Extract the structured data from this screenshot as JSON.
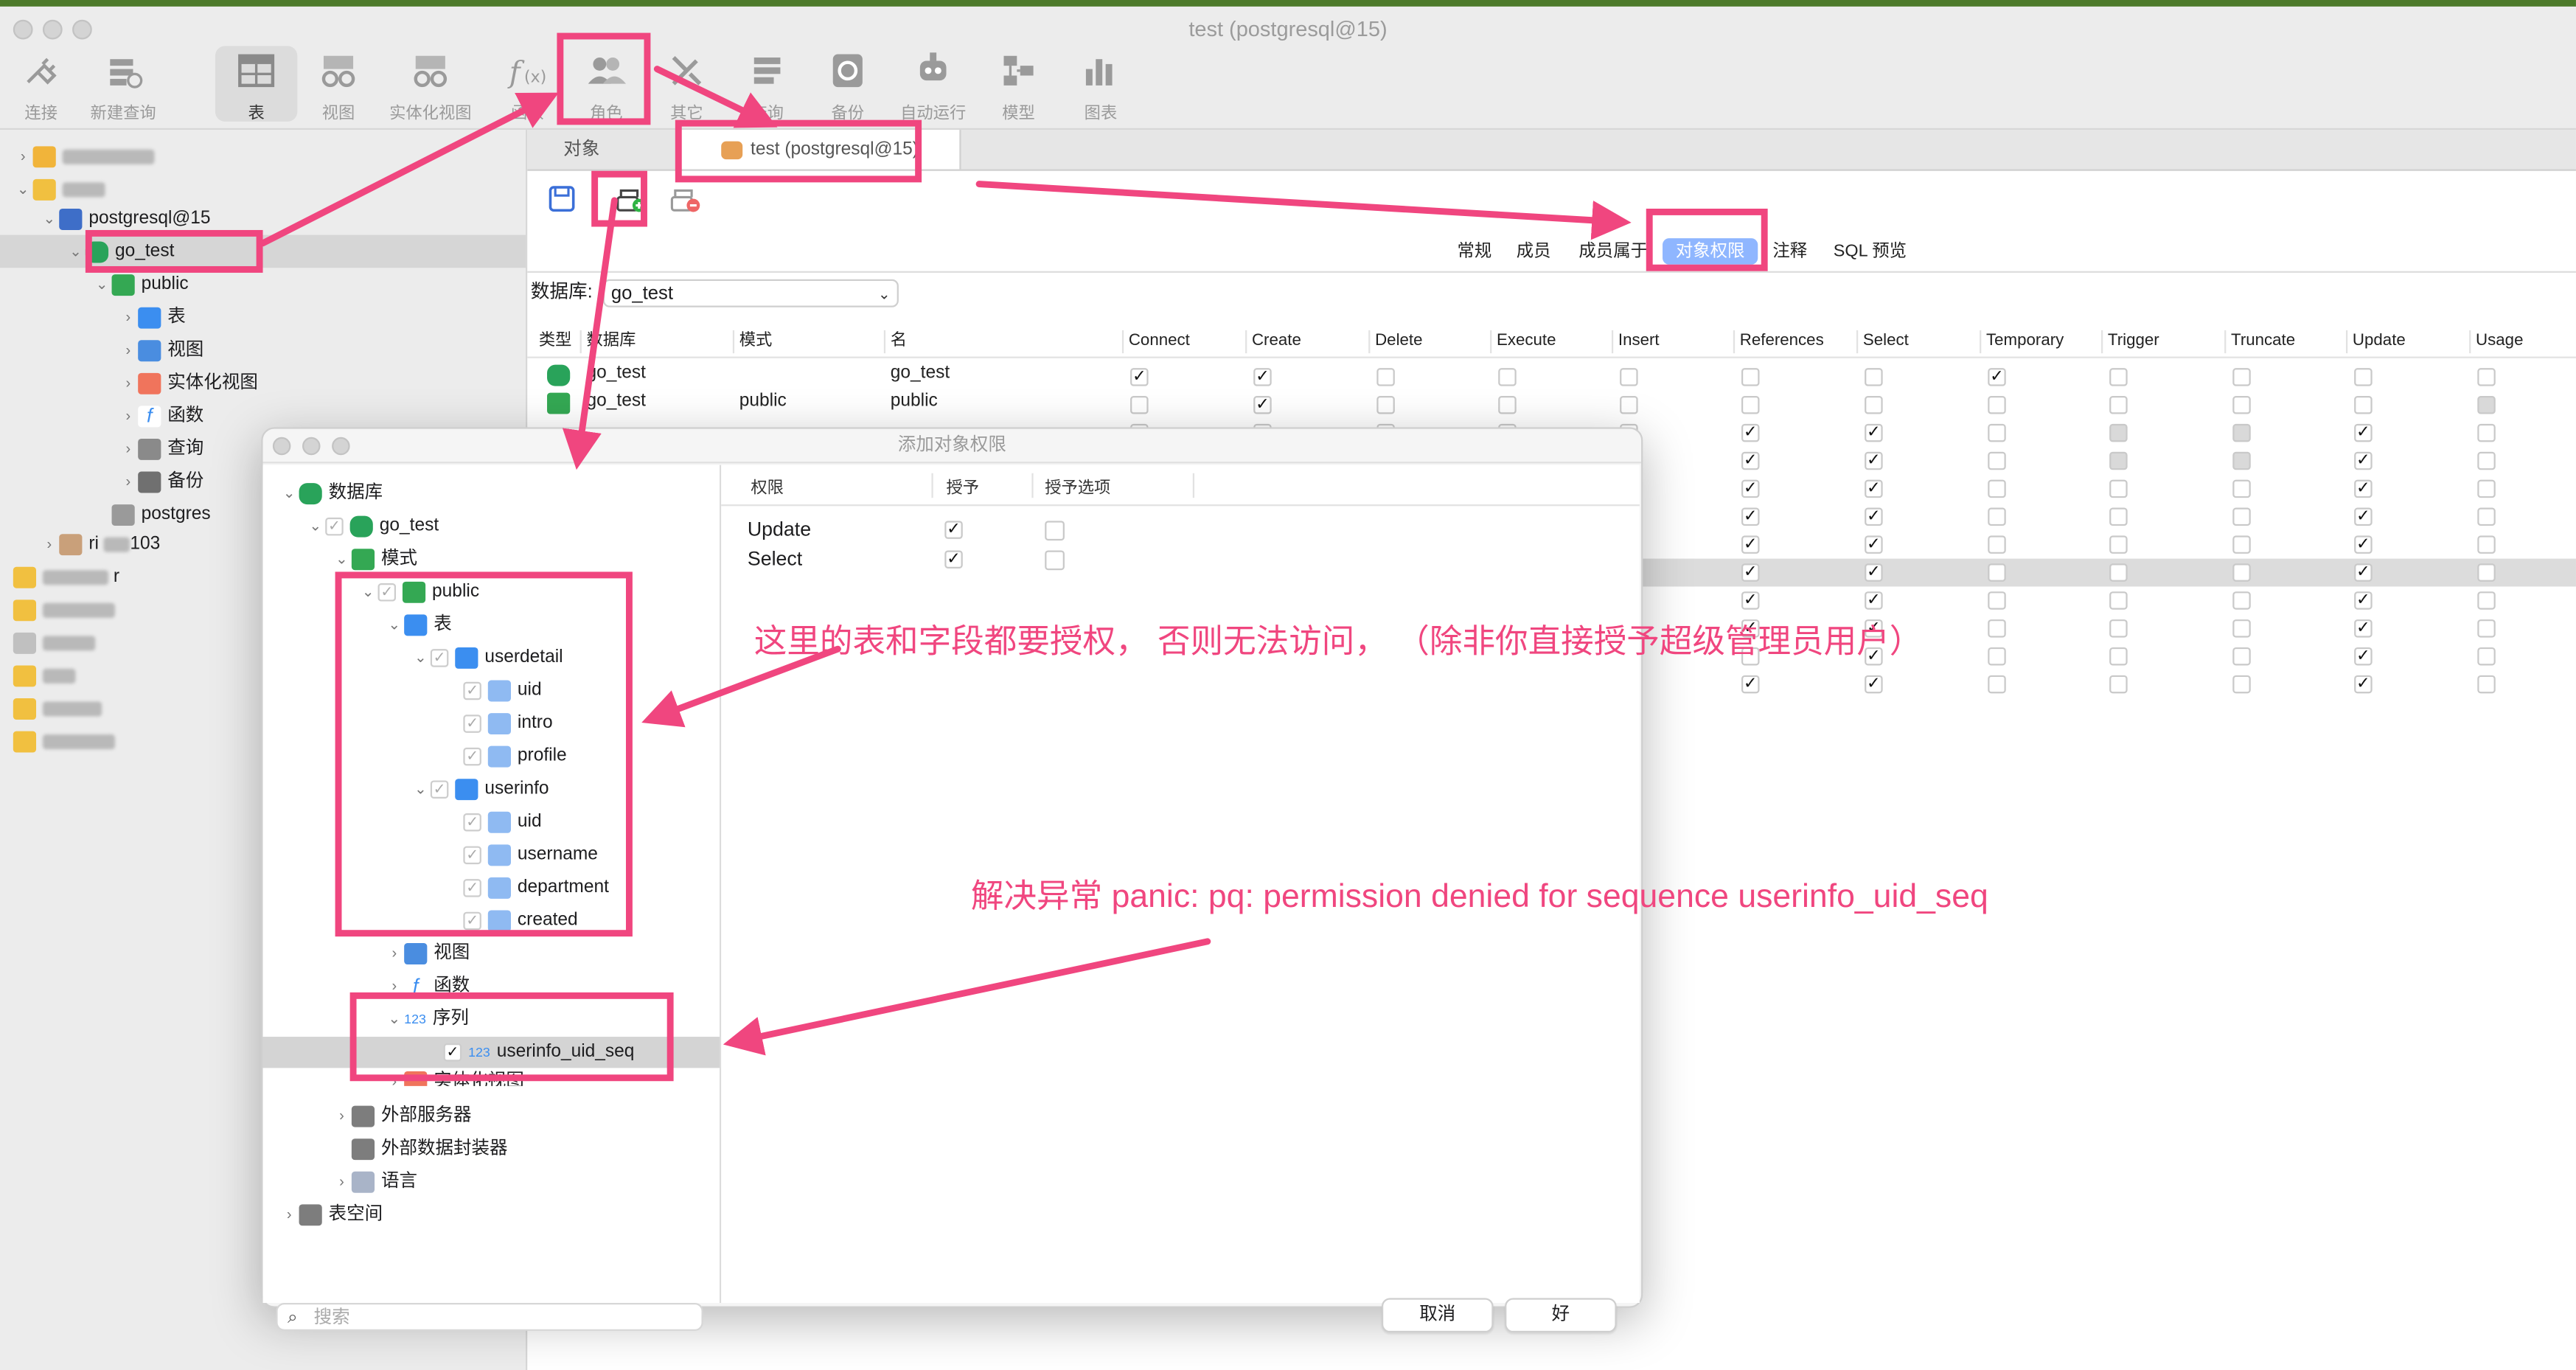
{
  "window": {
    "title": "test (postgresql@15)"
  },
  "toolbar": {
    "items": [
      {
        "label": "连接",
        "icon": "plug-icon"
      },
      {
        "label": "新建查询",
        "icon": "new-query-icon"
      },
      {
        "label": "表",
        "icon": "table-icon"
      },
      {
        "label": "视图",
        "icon": "view-icon"
      },
      {
        "label": "实体化视图",
        "icon": "materialized-view-icon"
      },
      {
        "label": "函数",
        "icon": "function-icon"
      },
      {
        "label": "角色",
        "icon": "roles-icon"
      },
      {
        "label": "其它",
        "icon": "tools-icon"
      },
      {
        "label": "查询",
        "icon": "query-icon"
      },
      {
        "label": "备份",
        "icon": "backup-icon"
      },
      {
        "label": "自动运行",
        "icon": "robot-icon"
      },
      {
        "label": "模型",
        "icon": "model-icon"
      },
      {
        "label": "图表",
        "icon": "chart-icon"
      }
    ]
  },
  "sidebar": {
    "items": [
      {
        "label": "postgresql@15"
      },
      {
        "label": "go_test"
      },
      {
        "label": "public"
      },
      {
        "label": "表"
      },
      {
        "label": "视图"
      },
      {
        "label": "实体化视图"
      },
      {
        "label": "函数"
      },
      {
        "label": "查询"
      },
      {
        "label": "备份"
      },
      {
        "label": "postgres"
      },
      {
        "label": "ri",
        "suffix": "103"
      },
      {
        "label": "r"
      }
    ]
  },
  "tabs": [
    {
      "label": "对象"
    },
    {
      "label": "test (postgresql@15)"
    }
  ],
  "subtabs": [
    {
      "label": "常规"
    },
    {
      "label": "成员"
    },
    {
      "label": "成员属于"
    },
    {
      "label": "对象权限"
    },
    {
      "label": "注释"
    },
    {
      "label": "SQL 预览"
    }
  ],
  "db_filter": {
    "label": "数据库:",
    "value": "go_test"
  },
  "grid": {
    "headers": [
      "类型",
      "数据库",
      "模式",
      "名",
      "Connect",
      "Create",
      "Delete",
      "Execute",
      "Insert",
      "References",
      "Select",
      "Temporary",
      "Trigger",
      "Truncate",
      "Update",
      "Usage"
    ],
    "rows": [
      {
        "db": "go_test",
        "schema": "",
        "name": "go_test"
      },
      {
        "db": "go_test",
        "schema": "public",
        "name": "public"
      }
    ]
  },
  "dialog": {
    "title": "添加对象权限",
    "tree": [
      {
        "label": "数据库"
      },
      {
        "label": "go_test"
      },
      {
        "label": "模式"
      },
      {
        "label": "public"
      },
      {
        "label": "表"
      },
      {
        "label": "userdetail"
      },
      {
        "label": "uid"
      },
      {
        "label": "intro"
      },
      {
        "label": "profile"
      },
      {
        "label": "userinfo"
      },
      {
        "label": "uid"
      },
      {
        "label": "username"
      },
      {
        "label": "department"
      },
      {
        "label": "created"
      },
      {
        "label": "视图"
      },
      {
        "label": "函数"
      },
      {
        "label": "序列"
      },
      {
        "label": "userinfo_uid_seq"
      },
      {
        "label": "实体化视图"
      },
      {
        "label": "外部服务器"
      },
      {
        "label": "外部数据封装器"
      },
      {
        "label": "语言"
      },
      {
        "label": "表空间"
      }
    ],
    "perm_headers": [
      "权限",
      "授予",
      "授予选项"
    ],
    "perms": [
      {
        "name": "Update"
      },
      {
        "name": "Select"
      }
    ],
    "search_placeholder": "搜索",
    "cancel": "取消",
    "ok": "好",
    "seq_badge": "123"
  },
  "annotations": {
    "note1": "这里的表和字段都要授权， 否则无法访问， （除非你直接授予超级管理员用户）",
    "note2": "解决异常  panic: pq: permission denied for sequence userinfo_uid_seq"
  },
  "colors": {
    "accent": "#f0467f",
    "tab_active": "#8fb6ff"
  }
}
